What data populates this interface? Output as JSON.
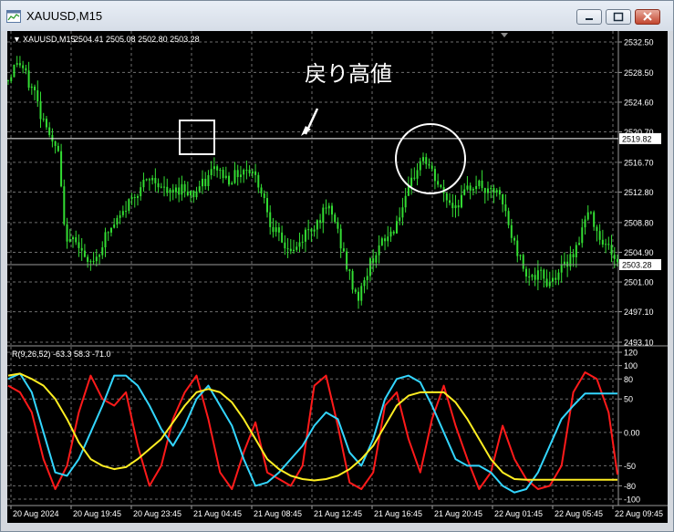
{
  "window": {
    "title": "XAUUSD,M15"
  },
  "colors": {
    "background": "#000000",
    "grid": "#6e6e6e",
    "candles": "#33dd33",
    "text": "#ffffff",
    "red_line": "#ff1a1a",
    "cyan_line": "#33d6ff",
    "yellow_line": "#ffee22"
  },
  "main_header": {
    "label": "XAUUSD,M15",
    "ohlc": "2504.41 2505.08 2502.80 2503.28"
  },
  "annotation": {
    "text": "戻り高値"
  },
  "indicator_header": {
    "label": "R(9,26,52) -63.3 58.3 -71.0"
  },
  "chart_data": [
    {
      "type": "candlestick",
      "series_name": "XAUUSD,M15",
      "ylim": [
        2493.1,
        2532.5
      ],
      "y_ticks": [
        2532.5,
        2528.5,
        2524.6,
        2520.7,
        2516.7,
        2512.8,
        2508.8,
        2504.9,
        2501.0,
        2497.1,
        2493.1
      ],
      "y_tick_labels": [
        "2532.50",
        "2528.50",
        "2524.60",
        "2520.70",
        "2516.70",
        "2512.80",
        "2508.80",
        "2504.90",
        "2501.00",
        "2497.10",
        "2493.10"
      ],
      "horizontal_lines": [
        {
          "value": 2519.82,
          "label": "2519.82",
          "color": "#ffffff"
        },
        {
          "value": 2503.28,
          "label": "2503.28",
          "color": "#9a9a9a"
        }
      ],
      "close_path": [
        [
          0,
          2527.5
        ],
        [
          3,
          2530
        ],
        [
          5,
          2529
        ],
        [
          7,
          2527
        ],
        [
          9,
          2526
        ],
        [
          11,
          2523
        ],
        [
          13,
          2522
        ],
        [
          15,
          2519
        ],
        [
          17,
          2518
        ],
        [
          19,
          2508
        ],
        [
          21,
          2506
        ],
        [
          23,
          2507
        ],
        [
          25,
          2505
        ],
        [
          27,
          2503
        ],
        [
          29,
          2504
        ],
        [
          31,
          2505
        ],
        [
          33,
          2507
        ],
        [
          35,
          2508
        ],
        [
          37,
          2509
        ],
        [
          39,
          2510
        ],
        [
          41,
          2511.5
        ],
        [
          43,
          2512.5
        ],
        [
          45,
          2513.5
        ],
        [
          47,
          2514
        ],
        [
          49,
          2514.5
        ],
        [
          51,
          2514
        ],
        [
          53,
          2513
        ],
        [
          55,
          2512.5
        ],
        [
          57,
          2513
        ],
        [
          59,
          2513.5
        ],
        [
          61,
          2513
        ],
        [
          63,
          2512.5
        ],
        [
          65,
          2513.5
        ],
        [
          67,
          2514
        ],
        [
          69,
          2515.5
        ],
        [
          71,
          2516
        ],
        [
          73,
          2515
        ],
        [
          75,
          2514.5
        ],
        [
          77,
          2515
        ],
        [
          79,
          2515.5
        ],
        [
          81,
          2516
        ],
        [
          83,
          2515.5
        ],
        [
          85,
          2514
        ],
        [
          87,
          2512
        ],
        [
          89,
          2509
        ],
        [
          91,
          2507.5
        ],
        [
          93,
          2506
        ],
        [
          95,
          2505.5
        ],
        [
          97,
          2505
        ],
        [
          99,
          2506
        ],
        [
          101,
          2507.5
        ],
        [
          103,
          2508
        ],
        [
          105,
          2509
        ],
        [
          107,
          2510
        ],
        [
          109,
          2510.5
        ],
        [
          111,
          2509
        ],
        [
          113,
          2506
        ],
        [
          115,
          2503
        ],
        [
          117,
          2500.5
        ],
        [
          119,
          2499
        ],
        [
          121,
          2501
        ],
        [
          123,
          2503.5
        ],
        [
          125,
          2505
        ],
        [
          127,
          2506
        ],
        [
          129,
          2507
        ],
        [
          131,
          2508
        ],
        [
          133,
          2510
        ],
        [
          135,
          2511.5
        ],
        [
          137,
          2514
        ],
        [
          139,
          2516
        ],
        [
          141,
          2517.5
        ],
        [
          143,
          2516
        ],
        [
          145,
          2514.5
        ],
        [
          147,
          2513
        ],
        [
          149,
          2512
        ],
        [
          151,
          2511
        ],
        [
          153,
          2511.5
        ],
        [
          155,
          2512.5
        ],
        [
          157,
          2513.5
        ],
        [
          159,
          2514
        ],
        [
          161,
          2513.5
        ],
        [
          163,
          2512.5
        ],
        [
          165,
          2513
        ],
        [
          167,
          2512
        ],
        [
          169,
          2510
        ],
        [
          171,
          2507
        ],
        [
          173,
          2505
        ],
        [
          175,
          2503
        ],
        [
          177,
          2502
        ],
        [
          179,
          2501.5
        ],
        [
          181,
          2502
        ],
        [
          183,
          2501
        ],
        [
          185,
          2501.5
        ],
        [
          187,
          2502.5
        ],
        [
          189,
          2503
        ],
        [
          191,
          2504.5
        ],
        [
          193,
          2505.5
        ],
        [
          195,
          2508
        ],
        [
          197,
          2510
        ],
        [
          199,
          2509
        ],
        [
          201,
          2507
        ],
        [
          203,
          2506
        ],
        [
          205,
          2505
        ],
        [
          207,
          2503.28
        ]
      ]
    },
    {
      "type": "line",
      "ylim": [
        -100,
        120
      ],
      "y_ticks": [
        120,
        100,
        80,
        50,
        0,
        -50,
        -80,
        -100
      ],
      "y_tick_labels": [
        "120",
        "100",
        "80",
        "50",
        "0.00",
        "-50",
        "-80",
        "-100"
      ],
      "x_tick_labels": [
        "20 Aug 2024",
        "20 Aug 19:45",
        "20 Aug 23:45",
        "21 Aug 04:45",
        "21 Aug 08:45",
        "21 Aug 12:45",
        "21 Aug 16:45",
        "21 Aug 20:45",
        "22 Aug 01:45",
        "22 Aug 05:45",
        "22 Aug 09:45"
      ],
      "x": [
        0,
        4,
        8,
        12,
        16,
        20,
        24,
        28,
        32,
        36,
        40,
        44,
        48,
        52,
        56,
        60,
        64,
        68,
        72,
        76,
        80,
        84,
        88,
        92,
        96,
        100,
        104,
        108,
        112,
        116,
        120,
        124,
        128,
        132,
        136,
        140,
        144,
        148,
        152,
        156,
        160,
        164,
        168,
        172,
        176,
        180,
        184,
        188,
        192,
        196,
        200,
        204,
        207
      ],
      "series": [
        {
          "name": "R9",
          "color": "#ff1a1a",
          "values": [
            70,
            60,
            30,
            -40,
            -85,
            -50,
            30,
            85,
            50,
            40,
            60,
            -20,
            -80,
            -50,
            20,
            60,
            85,
            20,
            -60,
            -85,
            -30,
            15,
            -60,
            -70,
            -80,
            -50,
            70,
            85,
            10,
            -75,
            -85,
            -60,
            40,
            60,
            -10,
            -60,
            20,
            70,
            10,
            -40,
            -85,
            -60,
            10,
            -40,
            -70,
            -85,
            -80,
            -50,
            60,
            90,
            80,
            30,
            -63.3
          ]
        },
        {
          "name": "R26",
          "color": "#33d6ff",
          "values": [
            80,
            88,
            60,
            0,
            -60,
            -65,
            -40,
            0,
            40,
            85,
            85,
            70,
            40,
            5,
            -20,
            10,
            50,
            70,
            40,
            10,
            -40,
            -80,
            -75,
            -60,
            -40,
            -20,
            10,
            30,
            20,
            -30,
            -50,
            -10,
            50,
            80,
            85,
            75,
            40,
            0,
            -40,
            -50,
            -50,
            -60,
            -80,
            -90,
            -85,
            -60,
            -20,
            20,
            40,
            58.3,
            58.3,
            58.3,
            58.3
          ]
        },
        {
          "name": "R52",
          "color": "#ffee22",
          "values": [
            85,
            88,
            80,
            70,
            50,
            20,
            -15,
            -40,
            -50,
            -55,
            -52,
            -40,
            -25,
            -10,
            15,
            40,
            60,
            65,
            60,
            45,
            20,
            -10,
            -40,
            -55,
            -65,
            -70,
            -72,
            -70,
            -65,
            -55,
            -40,
            -20,
            10,
            40,
            55,
            60,
            60,
            60,
            45,
            20,
            -10,
            -40,
            -60,
            -70,
            -71,
            -71,
            -71,
            -71,
            -71,
            -71,
            -71,
            -71,
            -71.0
          ]
        }
      ]
    }
  ]
}
